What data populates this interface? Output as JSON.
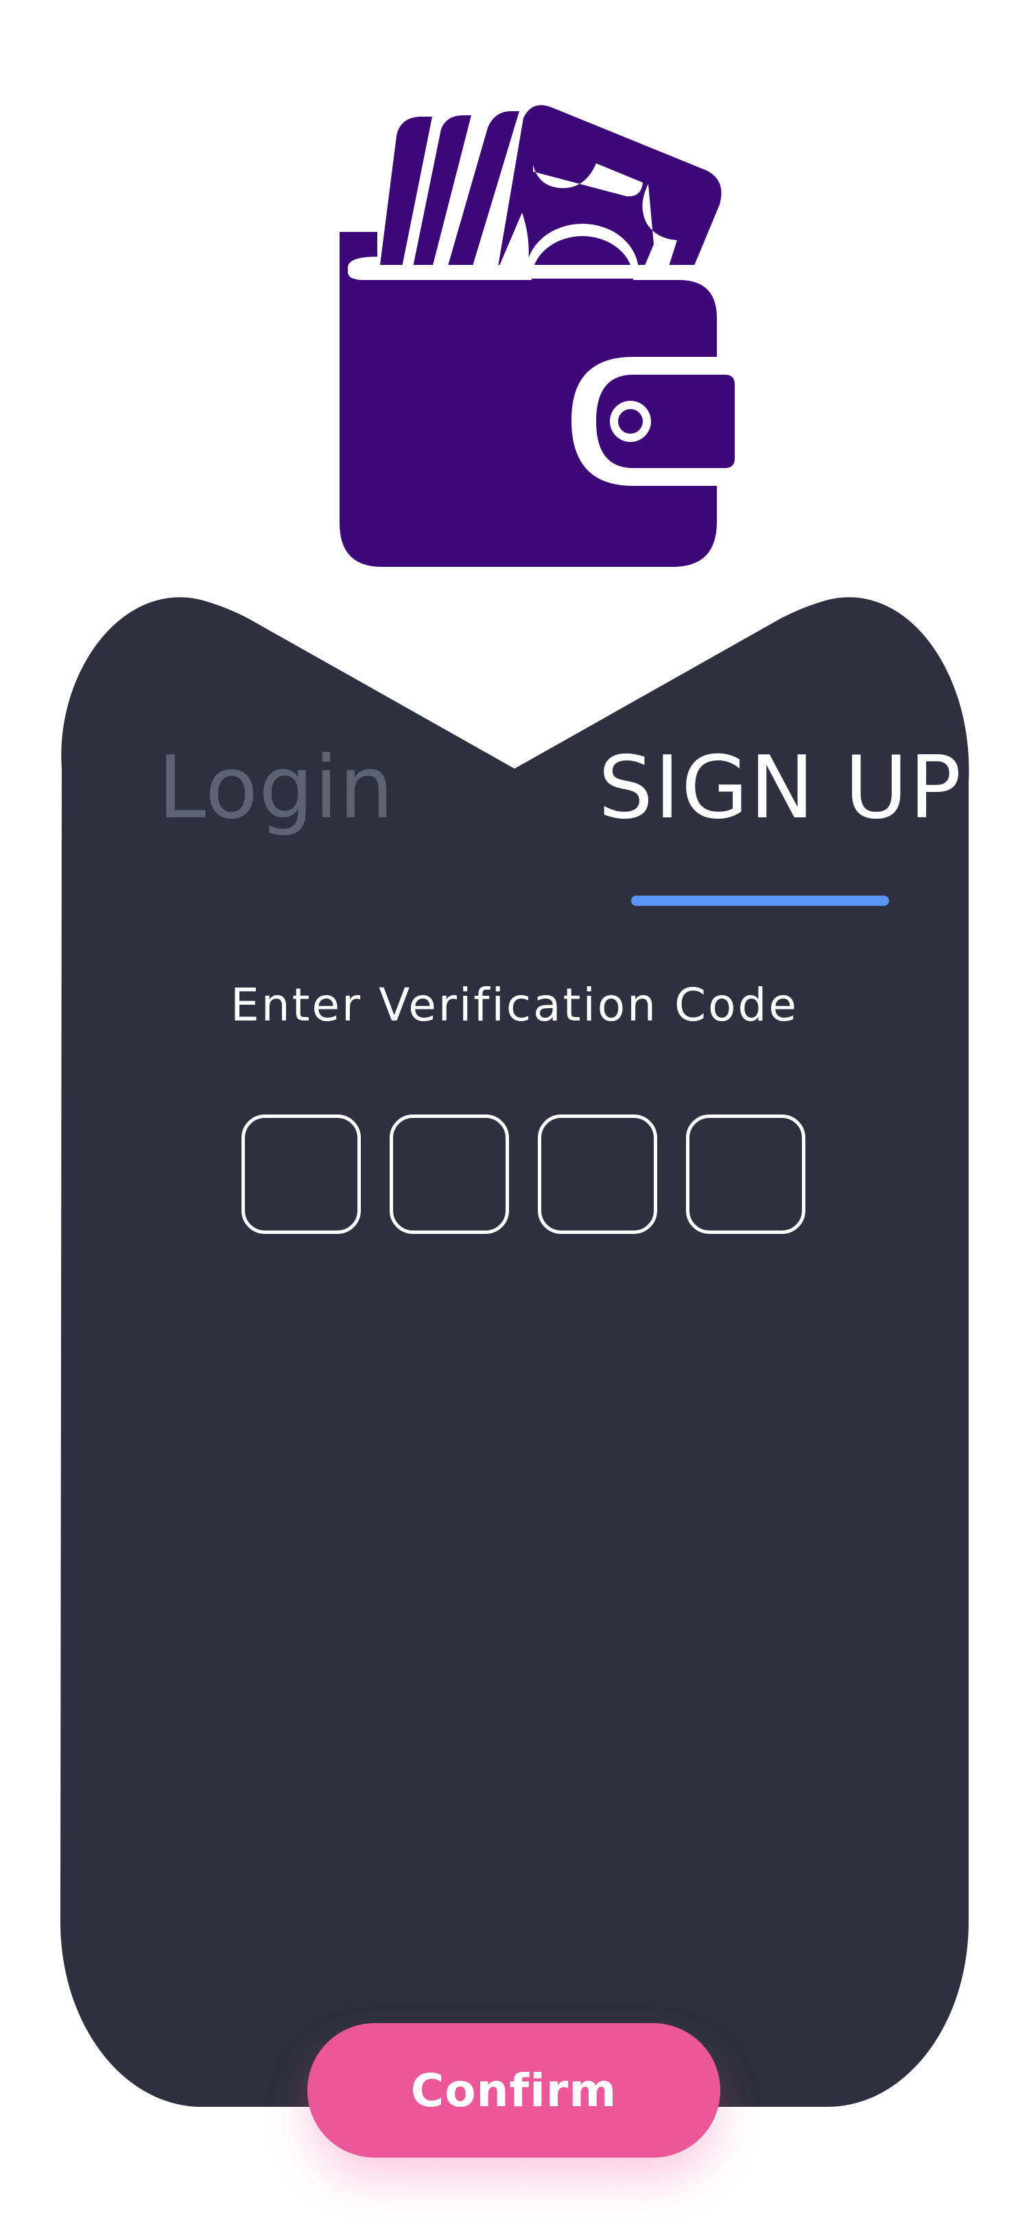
{
  "app": {
    "logo_icon": "wallet-icon"
  },
  "colors": {
    "brand": "#3c0777",
    "card": "#2e303f",
    "tab_indicator": "#5996f5",
    "confirm": "#ec579a",
    "inactive_tab": "#5f6272"
  },
  "tabs": [
    {
      "label": "Login",
      "active": false
    },
    {
      "label": "SIGN UP",
      "active": true
    }
  ],
  "verification": {
    "heading": "Enter Verification Code",
    "code_digits": [
      "",
      "",
      "",
      ""
    ]
  },
  "actions": {
    "confirm_label": "Confirm"
  }
}
